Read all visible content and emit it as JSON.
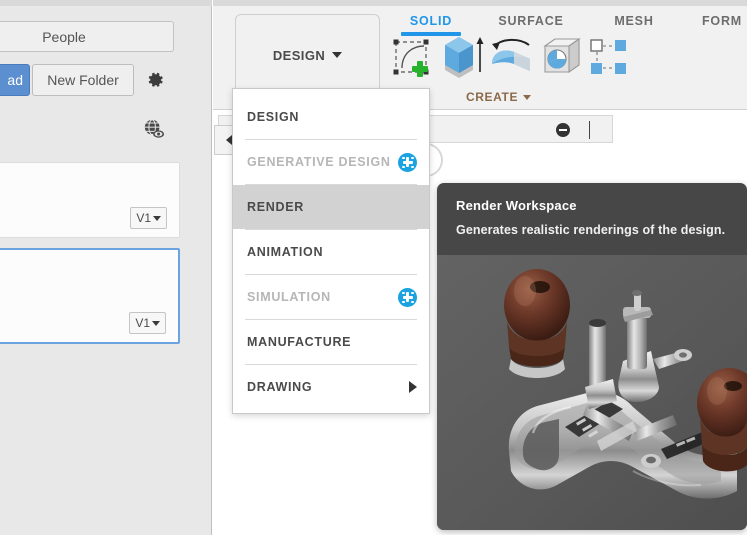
{
  "left_panel": {
    "tabs": [
      {
        "label": "People",
        "name": "tab-people"
      }
    ],
    "upload_button": "ad",
    "new_folder_button": "New Folder",
    "settings_icon": "gear-icon",
    "visibility_icon": "globe-eye-icon",
    "files": [
      {
        "version": "V1",
        "selected": false
      },
      {
        "version": "V1",
        "selected": true
      }
    ]
  },
  "ribbon": {
    "workspace_button": "DESIGN",
    "tabs": [
      {
        "label": "SOLID",
        "active": true
      },
      {
        "label": "SURFACE",
        "active": false
      },
      {
        "label": "MESH",
        "active": false
      },
      {
        "label": "FORM",
        "active": false
      }
    ],
    "panels": [
      {
        "label": "CREATE",
        "tools": [
          {
            "name": "create-sketch-icon"
          },
          {
            "name": "extrude-icon"
          },
          {
            "name": "revolve-icon"
          },
          {
            "name": "sweep-icon"
          },
          {
            "name": "pattern-icon"
          },
          {
            "name": "thicken-icon"
          },
          {
            "name": "patch-icon"
          }
        ]
      }
    ],
    "accent_color": "#2196e8",
    "panel_label_color": "#8a6a4a"
  },
  "workspace_menu": {
    "items": [
      {
        "label": "DESIGN",
        "state": "normal",
        "badge": false,
        "submenu": false
      },
      {
        "label": "GENERATIVE DESIGN",
        "state": "disabled",
        "badge": true,
        "submenu": false
      },
      {
        "label": "RENDER",
        "state": "highlight",
        "badge": false,
        "submenu": false
      },
      {
        "label": "ANIMATION",
        "state": "normal",
        "badge": false,
        "submenu": false
      },
      {
        "label": "SIMULATION",
        "state": "disabled",
        "badge": true,
        "submenu": false
      },
      {
        "label": "MANUFACTURE",
        "state": "normal",
        "badge": false,
        "submenu": false
      },
      {
        "label": "DRAWING",
        "state": "normal",
        "badge": false,
        "submenu": true
      }
    ],
    "highlight_color": "#d2d2d2",
    "badge_color": "#1aa3e0"
  },
  "tooltip": {
    "title": "Render Workspace",
    "description": "Generates realistic renderings of the design.",
    "image_alt": "rendered-router-plane",
    "background_color": "#474747"
  },
  "document_tabbar": {
    "minimize_icon": "minus-circle-icon"
  }
}
